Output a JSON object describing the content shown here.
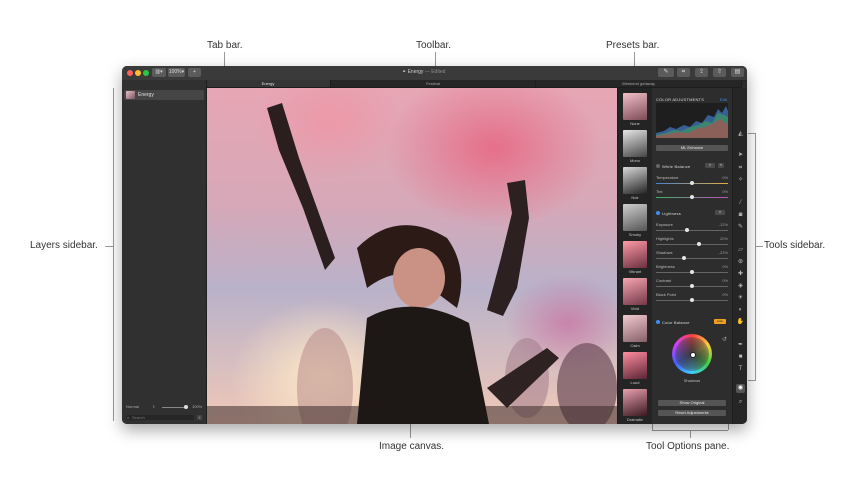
{
  "callouts": {
    "tab_bar": "Tab bar.",
    "toolbar": "Toolbar.",
    "presets_bar": "Presets bar.",
    "layers_sidebar": "Layers sidebar.",
    "tools_sidebar": "Tools sidebar.",
    "image_canvas": "Image canvas.",
    "tool_options": "Tool Options pane."
  },
  "window": {
    "zoom": "100%",
    "document_name": "Energy",
    "document_status": "Edited",
    "tabs": [
      {
        "label": "Energy",
        "active": true
      },
      {
        "label": "Festival",
        "active": false
      },
      {
        "label": "Weekend getaway",
        "active": false
      }
    ]
  },
  "layers": {
    "items": [
      {
        "name": "Energy"
      }
    ],
    "blend_mode": "Normal",
    "opacity": "100%",
    "search_placeholder": "Search"
  },
  "presets": [
    {
      "label": "None"
    },
    {
      "label": "Mono"
    },
    {
      "label": "Noir"
    },
    {
      "label": "Smoky"
    },
    {
      "label": "Vibrant"
    },
    {
      "label": "Vivid"
    },
    {
      "label": "Calm"
    },
    {
      "label": "Loud"
    },
    {
      "label": "Dramatic"
    }
  ],
  "tool_options": {
    "title": "COLOR ADJUSTMENTS",
    "edit_label": "Edit",
    "ml_button": "ML Enhance",
    "white_balance": {
      "title": "White Balance",
      "sliders": [
        {
          "label": "Temperature",
          "value": "0%"
        },
        {
          "label": "Tint",
          "value": "0%"
        }
      ]
    },
    "lightness": {
      "title": "Lightness",
      "sliders": [
        {
          "label": "Exposure",
          "value": "-12%"
        },
        {
          "label": "Highlights",
          "value": "20%"
        },
        {
          "label": "Shadows",
          "value": "-23%"
        },
        {
          "label": "Brightness",
          "value": "0%"
        },
        {
          "label": "Contrast",
          "value": "0%"
        },
        {
          "label": "Black Point",
          "value": "0%"
        }
      ]
    },
    "color_balance": {
      "title": "Color Balance",
      "badge": "Auto",
      "wheel_label": "Shadows"
    },
    "show_original": "Show Original",
    "reset": "Reset Adjustments"
  },
  "colors": {
    "accent": "#3d8ef2",
    "window_bg": "#2b2b2b",
    "badge": "#f0a020"
  }
}
